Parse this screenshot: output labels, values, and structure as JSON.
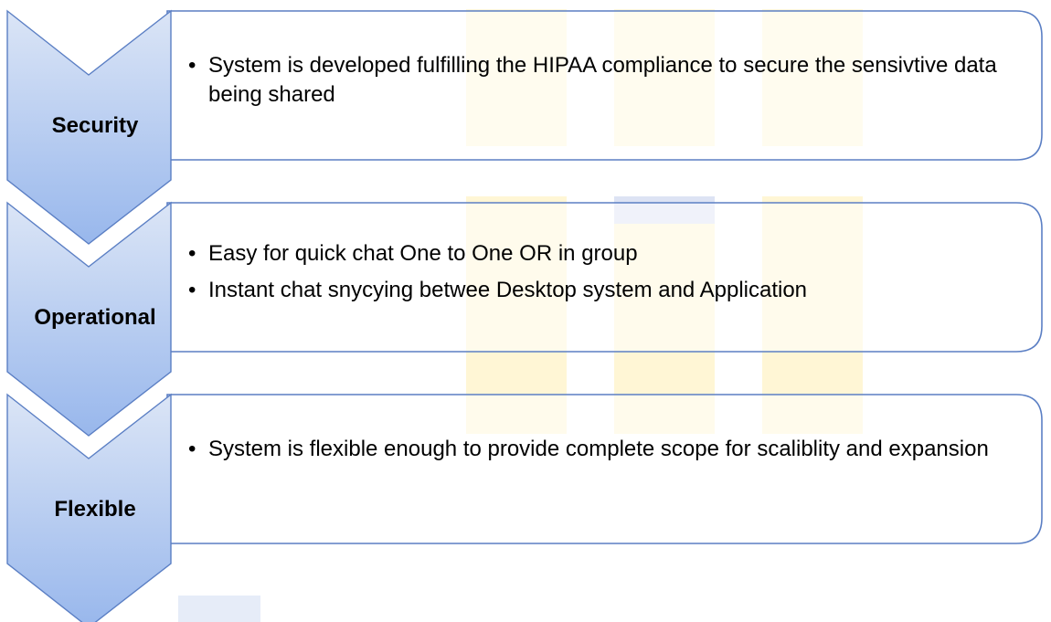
{
  "colors": {
    "chevron_light": "#dbe5f6",
    "chevron_dark": "#98b7ec",
    "chevron_stroke": "#5b7fc4",
    "panel_stroke": "#5b7fc4",
    "watermark_yellow": "#fff6d5",
    "watermark_blue": "#dde3f4"
  },
  "steps": [
    {
      "label": "Security",
      "bullets": [
        "System is developed fulfilling the HIPAA compliance to secure the sensivtive data being shared"
      ]
    },
    {
      "label": "Operational",
      "bullets": [
        "Easy for quick chat One to One OR in group",
        "Instant chat snycying betwee Desktop system and Application"
      ]
    },
    {
      "label": "Flexible",
      "bullets": [
        "System is flexible enough to provide complete scope for scaliblity and expansion"
      ]
    }
  ]
}
